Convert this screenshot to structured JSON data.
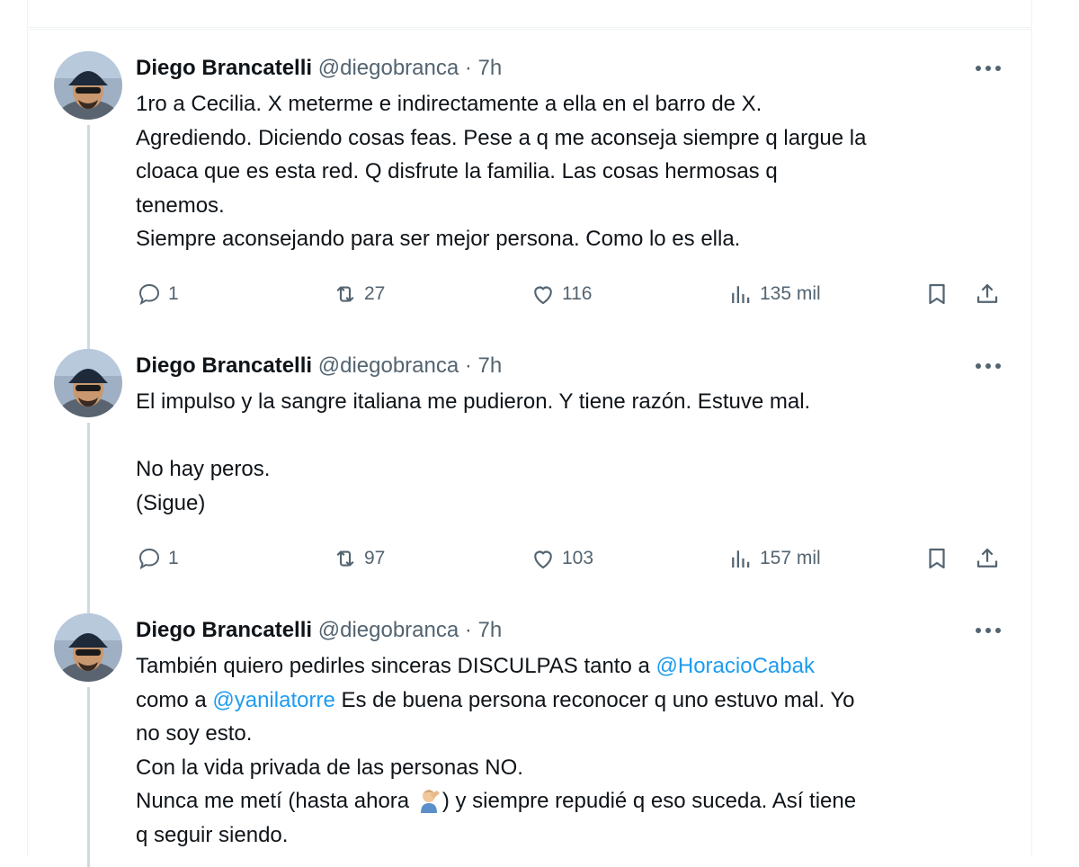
{
  "author": {
    "name": "Diego Brancatelli",
    "handle": "@diegobranca",
    "separator": "·"
  },
  "tweets": [
    {
      "time": "7h",
      "lines": [
        "1ro a Cecilia. X meterme e indirectamente a ella en el barro de X.",
        "Agrediendo. Diciendo cosas feas. Pese a q me aconseja siempre q largue la",
        "cloaca que es esta red. Q disfrute la familia. Las cosas hermosas q",
        "tenemos.",
        "Siempre aconsejando para ser mejor persona. Como lo es ella."
      ],
      "replies": "1",
      "reposts": "27",
      "likes": "116",
      "views": "135 mil"
    },
    {
      "time": "7h",
      "lines": [
        "El impulso y la sangre italiana me pudieron. Y tiene razón. Estuve mal.",
        "",
        "No hay peros.",
        "(Sigue)"
      ],
      "replies": "1",
      "reposts": "97",
      "likes": "103",
      "views": "157 mil"
    },
    {
      "time": "7h",
      "line1_before": "También quiero pedirles sinceras DISCULPAS tanto a ",
      "mention1": "@HoracioCabak",
      "line2_before": "como a ",
      "mention2": "@yanilatorre",
      "line2_after": " Es de buena persona reconocer q uno estuvo mal. Yo",
      "line3": "no soy esto.",
      "line4": "Con la vida privada de las personas NO.",
      "line5_before": "Nunca me metí (hasta ahora ",
      "line5_after": ") y siempre repudié q eso suceda. Así tiene",
      "line6": "q seguir siendo."
    }
  ],
  "icons": {
    "more": "more-icon",
    "reply": "reply-icon",
    "repost": "repost-icon",
    "like": "like-icon",
    "views": "views-icon",
    "bookmark": "bookmark-icon",
    "share": "share-icon",
    "emoji": "facepalm-emoji"
  },
  "colors": {
    "text": "#0f1419",
    "secondary": "#536471",
    "link": "#1d9bf0",
    "border": "#eff3f4",
    "thread": "#cfd9de"
  }
}
